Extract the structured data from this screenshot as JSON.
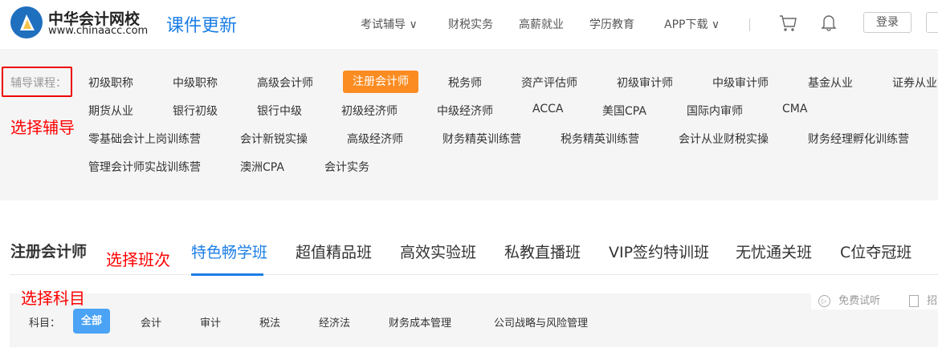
{
  "header": {
    "logo_name": "中华会计网校",
    "logo_url": "www.chinaacc.com",
    "title": "课件更新",
    "nav": [
      {
        "label": "考试辅导",
        "dropdown": true
      },
      {
        "label": "财税实务"
      },
      {
        "label": "高薪就业"
      },
      {
        "label": "学历教育"
      },
      {
        "label": "APP下载",
        "dropdown": true
      }
    ],
    "login": "登录"
  },
  "filter": {
    "label": "辅导课程：",
    "annotation": "选择辅导",
    "rows": [
      [
        "初级职称",
        "中级职称",
        "高级会计师",
        "注册会计师",
        "税务师",
        "资产评估师",
        "初级审计师",
        "中级审计师",
        "基金从业",
        "证券从业"
      ],
      [
        "期货从业",
        "银行初级",
        "银行中级",
        "初级经济师",
        "中级经济师",
        "ACCA",
        "美国CPA",
        "国际内审师",
        "CMA"
      ],
      [
        "零基础会计上岗训练营",
        "会计新锐实操",
        "高级经济师",
        "财务精英训练营",
        "税务精英训练营",
        "会计从业财税实操",
        "财务经理孵化训练营"
      ],
      [
        "管理会计师实战训练营",
        "澳洲CPA",
        "会计实务"
      ]
    ],
    "active": "注册会计师",
    "accent": "#fb8c22"
  },
  "classes": {
    "title": "注册会计师",
    "annotation": "选择班次",
    "tabs": [
      "特色畅学班",
      "超值精品班",
      "高效实验班",
      "私教直播班",
      "VIP签约特训班",
      "无忧通关班",
      "C位夺冠班"
    ],
    "active": "特色畅学班",
    "accent": "#1a7ee6"
  },
  "subjects": {
    "annotation": "选择科目",
    "label": "科目：",
    "items": [
      "全部",
      "会计",
      "审计",
      "税法",
      "经济法",
      "财务成本管理",
      "公司战略与风险管理"
    ],
    "active": "全部",
    "tools": [
      {
        "icon": "play-circle-icon",
        "label": "免费试听"
      },
      {
        "icon": "document-check-icon",
        "label": "招"
      }
    ]
  }
}
